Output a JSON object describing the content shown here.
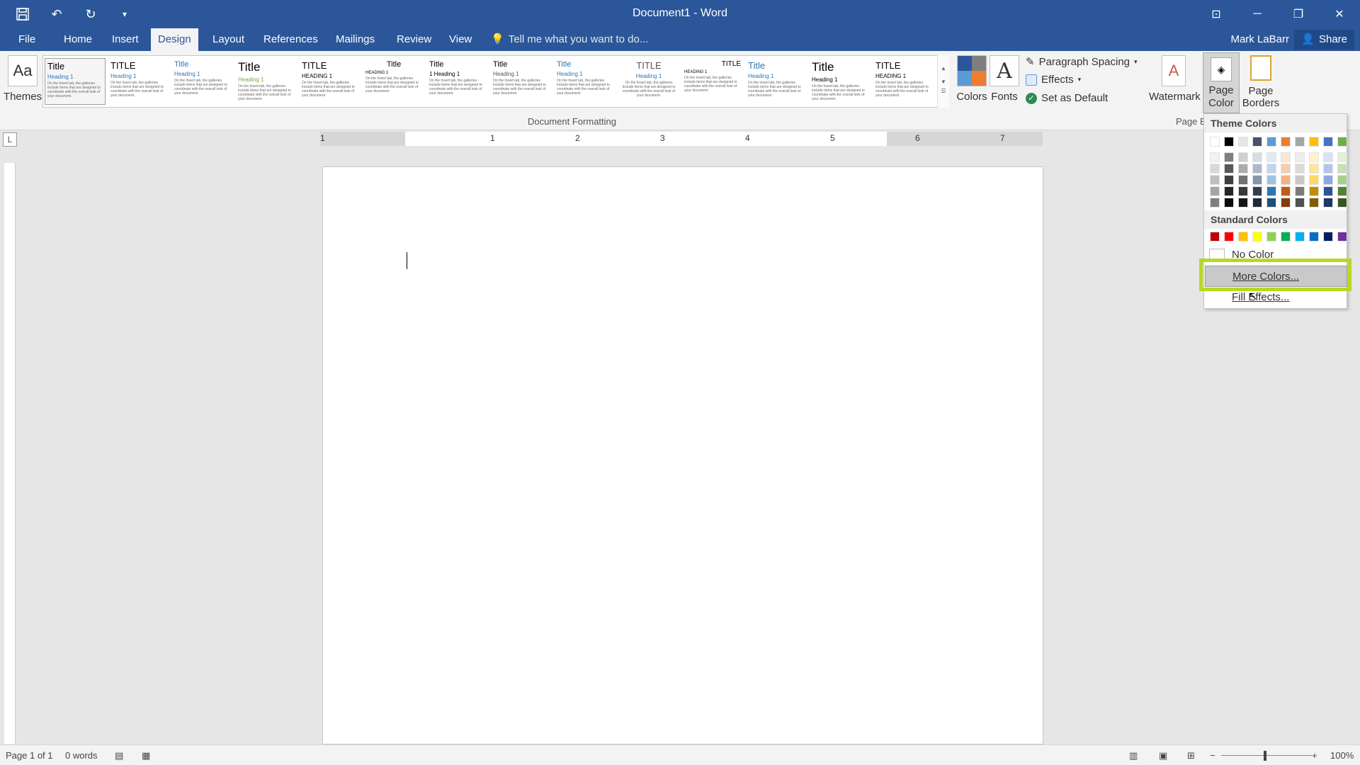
{
  "window": {
    "title": "Document1 - Word"
  },
  "qat": {
    "save": "💾",
    "undo": "↶",
    "redo": "↻",
    "more": "▾"
  },
  "tabs": [
    {
      "label": "File"
    },
    {
      "label": "Home"
    },
    {
      "label": "Insert"
    },
    {
      "label": "Design"
    },
    {
      "label": "Layout"
    },
    {
      "label": "References"
    },
    {
      "label": "Mailings"
    },
    {
      "label": "Review"
    },
    {
      "label": "View"
    }
  ],
  "tell_me": {
    "placeholder": "Tell me what you want to do..."
  },
  "user": {
    "name": "Mark LaBarr",
    "share": "Share"
  },
  "ribbon": {
    "themes_label": "Themes",
    "gallery_items": [
      {
        "title": "Title",
        "heading": "Heading 1"
      },
      {
        "title": "TITLE",
        "heading": "Heading 1"
      },
      {
        "title": "Title",
        "heading": "Heading 1"
      },
      {
        "title": "Title",
        "heading": "Heading 1"
      },
      {
        "title": "TITLE",
        "heading": "HEADING 1"
      },
      {
        "title": "Title",
        "heading": "HEADING 1"
      },
      {
        "title": "Title",
        "heading": "1 Heading 1"
      },
      {
        "title": "Title",
        "heading": "Heading 1"
      },
      {
        "title": "Title",
        "heading": "Heading 1"
      },
      {
        "title": "TITLE",
        "heading": "Heading 1"
      },
      {
        "title": "TITLE",
        "heading": "HEADING 1"
      },
      {
        "title": "Title",
        "heading": "Heading 1"
      },
      {
        "title": "Title",
        "heading": "Heading 1"
      },
      {
        "title": "TITLE",
        "heading": "HEADING 1"
      }
    ],
    "body_sample": "On the Insert tab, the galleries include items that are designed to coordinate with the overall look of your document.",
    "group_label": "Document Formatting",
    "colors_label": "Colors",
    "fonts_label": "Fonts",
    "paragraph_spacing": "Paragraph Spacing",
    "effects": "Effects",
    "set_default": "Set as Default",
    "watermark": "Watermark",
    "page_color": "Page Color",
    "page_borders": "Page Borders",
    "page_bg_group": "Page B"
  },
  "ruler": {
    "numbers": [
      "1",
      "1",
      "2",
      "3",
      "4",
      "5",
      "6",
      "7"
    ],
    "corner": "L"
  },
  "status": {
    "page": "Page 1 of 1",
    "words": "0 words",
    "zoom": "100%"
  },
  "dropdown": {
    "theme_header": "Theme Colors",
    "standard_header": "Standard Colors",
    "no_color": "No Color",
    "more_colors": "More Colors...",
    "fill_effects": "Fill Effects...",
    "theme_colors": [
      [
        "#ffffff",
        "#000000",
        "#e7e6e6",
        "#44546a",
        "#5b9bd5",
        "#ed7d31",
        "#a5a5a5",
        "#ffc000",
        "#4472c4",
        "#70ad47"
      ],
      [
        "#f2f2f2",
        "#7f7f7f",
        "#d0cece",
        "#d6dce4",
        "#deebf6",
        "#fbe5d5",
        "#ededed",
        "#fff2cc",
        "#d9e2f3",
        "#e2efd9"
      ],
      [
        "#d8d8d8",
        "#595959",
        "#aeabab",
        "#adb9ca",
        "#bdd7ee",
        "#f7cbac",
        "#dbdbdb",
        "#ffe599",
        "#b4c6e7",
        "#c5e0b3"
      ],
      [
        "#bfbfbf",
        "#3f3f3f",
        "#757070",
        "#8496b0",
        "#9cc3e5",
        "#f4b183",
        "#c9c9c9",
        "#ffd965",
        "#8eaadb",
        "#a8d08d"
      ],
      [
        "#a5a5a5",
        "#262626",
        "#3a3838",
        "#323f4f",
        "#2e75b5",
        "#c55a11",
        "#7b7b7b",
        "#bf9000",
        "#2f5496",
        "#538135"
      ],
      [
        "#7f7f7f",
        "#0c0c0c",
        "#171616",
        "#222a35",
        "#1e4e79",
        "#843c0b",
        "#525252",
        "#7f6000",
        "#1f3864",
        "#375623"
      ]
    ],
    "standard_colors": [
      "#c00000",
      "#ff0000",
      "#ffc000",
      "#ffff00",
      "#92d050",
      "#00b050",
      "#00b0f0",
      "#0070c0",
      "#002060",
      "#7030a0"
    ]
  }
}
